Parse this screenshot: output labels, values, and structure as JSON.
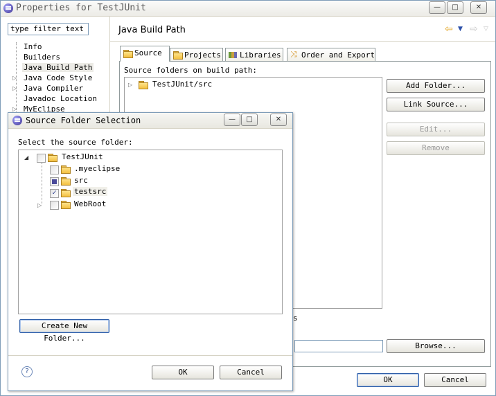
{
  "window": {
    "title": "Properties for TestJUnit",
    "controls": [
      "—",
      "□",
      "✕"
    ]
  },
  "filter": {
    "placeholder": "type filter text"
  },
  "nav": {
    "items": [
      "Info",
      "Builders",
      "Java Build Path",
      "Java Code Style",
      "Java Compiler",
      "Javadoc Location",
      "MyEclipse"
    ]
  },
  "page": {
    "heading": "Java Build Path",
    "tabs": [
      "Source",
      "Projects",
      "Libraries",
      "Order and Export"
    ],
    "source_label": "Source folders on build path:",
    "source_items": [
      "TestJUnit/src"
    ],
    "buttons": {
      "add_folder": "Add Folder...",
      "link_source": "Link Source...",
      "edit": "Edit...",
      "remove": "Remove",
      "browse": "Browse..."
    },
    "partial_text": "s",
    "ok": "OK",
    "cancel": "Cancel"
  },
  "dialog": {
    "title": "Source Folder Selection",
    "select_label": "Select the source folder:",
    "tree": {
      "root": "TestJUnit",
      "children": [
        ".myeclipse",
        "src",
        "testsrc",
        "WebRoot"
      ]
    },
    "create_new_folder": "Create New Folder...",
    "ok": "OK",
    "cancel": "Cancel",
    "help": "?"
  }
}
